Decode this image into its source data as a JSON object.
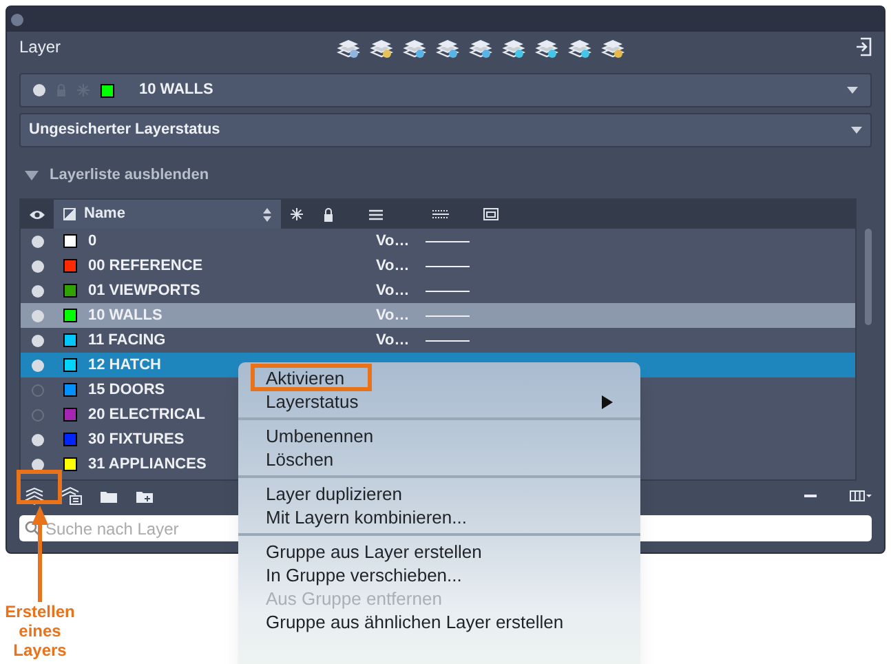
{
  "panel": {
    "title": "Layer"
  },
  "current_layer": {
    "name": "10 WALLS",
    "color": "#00ff00"
  },
  "layer_state": {
    "value": "Ungesicherter Layerstatus"
  },
  "list_toggle": {
    "label": "Layerliste ausblenden",
    "expanded": true
  },
  "table": {
    "columns": [
      {
        "label": "Name"
      }
    ],
    "rows": [
      {
        "name": "0",
        "color": "#ffffff",
        "on": true,
        "current": false,
        "selected": false,
        "linetype": "Vo…"
      },
      {
        "name": "00 REFERENCE",
        "color": "#ff2a00",
        "on": true,
        "current": false,
        "selected": false,
        "linetype": "Vo…"
      },
      {
        "name": "01 VIEWPORTS",
        "color": "#2fa400",
        "on": true,
        "current": false,
        "selected": false,
        "linetype": "Vo…"
      },
      {
        "name": "10 WALLS",
        "color": "#00ff00",
        "on": true,
        "current": true,
        "selected": false,
        "linetype": "Vo…"
      },
      {
        "name": "11 FACING",
        "color": "#00c8ff",
        "on": true,
        "current": false,
        "selected": false,
        "linetype": "Vo…"
      },
      {
        "name": "12 HATCH",
        "color": "#00d4ff",
        "on": true,
        "current": false,
        "selected": true
      },
      {
        "name": "15 DOORS",
        "color": "#0091ff",
        "on": false,
        "current": false,
        "selected": false
      },
      {
        "name": "20 ELECTRICAL",
        "color": "#a426b3",
        "on": false,
        "current": false,
        "selected": false
      },
      {
        "name": "30 FIXTURES",
        "color": "#0026ff",
        "on": true,
        "current": false,
        "selected": false
      },
      {
        "name": "31 APPLIANCES",
        "color": "#ffff00",
        "on": true,
        "current": false,
        "selected": false
      }
    ]
  },
  "search": {
    "placeholder": "Suche nach Layer"
  },
  "context_menu": {
    "groups": [
      {
        "items": [
          {
            "label": "Aktivieren",
            "disabled": false,
            "submenu": false,
            "highlighted": true
          },
          {
            "label": "Layerstatus",
            "disabled": false,
            "submenu": true,
            "highlighted": false
          }
        ]
      },
      {
        "items": [
          {
            "label": "Umbenennen",
            "disabled": false,
            "submenu": false,
            "highlighted": false
          },
          {
            "label": "Löschen",
            "disabled": false,
            "submenu": false,
            "highlighted": false
          }
        ]
      },
      {
        "items": [
          {
            "label": "Layer duplizieren",
            "disabled": false,
            "submenu": false,
            "highlighted": false
          },
          {
            "label": "Mit Layern kombinieren...",
            "disabled": false,
            "submenu": false,
            "highlighted": false
          }
        ]
      },
      {
        "items": [
          {
            "label": "Gruppe aus Layer erstellen",
            "disabled": false,
            "submenu": false,
            "highlighted": false
          },
          {
            "label": "In Gruppe verschieben...",
            "disabled": false,
            "submenu": false,
            "highlighted": false
          },
          {
            "label": "Aus Gruppe entfernen",
            "disabled": true,
            "submenu": false,
            "highlighted": false
          },
          {
            "label": "Gruppe aus ähnlichen Layer erstellen",
            "disabled": false,
            "submenu": false,
            "highlighted": false
          }
        ]
      }
    ]
  },
  "callout": {
    "label": "Erstellen eines Layers"
  }
}
